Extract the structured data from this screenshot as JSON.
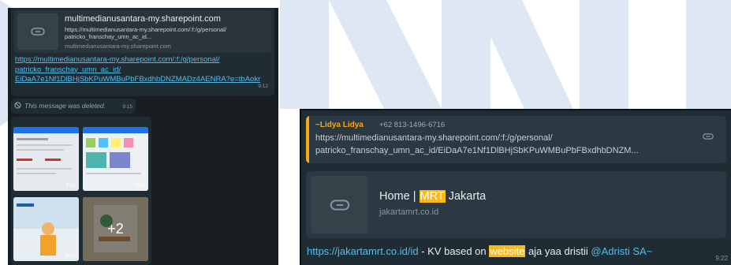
{
  "colors": {
    "watermark": "#dfe7f4",
    "chat_bg": "#0c1317",
    "bubble": "#202c33",
    "card": "#2a3942",
    "link": "#53bdeb",
    "quote_accent": "#f7a816",
    "highlight": "#fdb813"
  },
  "left": {
    "card_title": "multimedianusantara-my.sharepoint.com",
    "card_desc_1": "https://multimedianusantara-my.sharepoint.com/:f:/g/personal/",
    "card_desc_2": "patricko_franschay_umn_ac_id...",
    "card_host": "multimedianusantara-my.sharepoint.com",
    "url_line_1": "https://multimedianusantara-my.sharepoint.com/:f:/g/personal/",
    "url_line_2": "patricko_franschay_umn_ac_id/",
    "url_line_3": "EiDaA7e1Nf1DlBHjSbKPuWMBuPbFBxdhbDNZMADz4AENRA?e=tbAokr",
    "time_1": "9:12",
    "deleted_text": "This message was deleted.",
    "deleted_time": "9:15",
    "tile_times": [
      "9:15",
      "9:15",
      "9:15"
    ],
    "more_count": "+2"
  },
  "right": {
    "quote": {
      "sender": "~Lidya Lidya",
      "phone": "+62 813-1496-6716",
      "line_1": "https://multimedianusantara-my.sharepoint.com/:f:/g/personal/",
      "line_2": "patricko_franschay_umn_ac_id/EiDaA7e1Nf1DlBHjSbKPuWMBuPbFBxdhbDNZM..."
    },
    "preview": {
      "title_before": "Home | ",
      "title_highlight": "MRT",
      "title_after": " Jakarta",
      "host": "jakartamrt.co.id"
    },
    "message": {
      "link": "https://jakartamrt.co.id/id",
      "text_1": " - KV based on ",
      "highlight": "website",
      "text_2": " aja yaa dristii ",
      "mention": "@Adristi SA~"
    },
    "time": "9:22"
  }
}
